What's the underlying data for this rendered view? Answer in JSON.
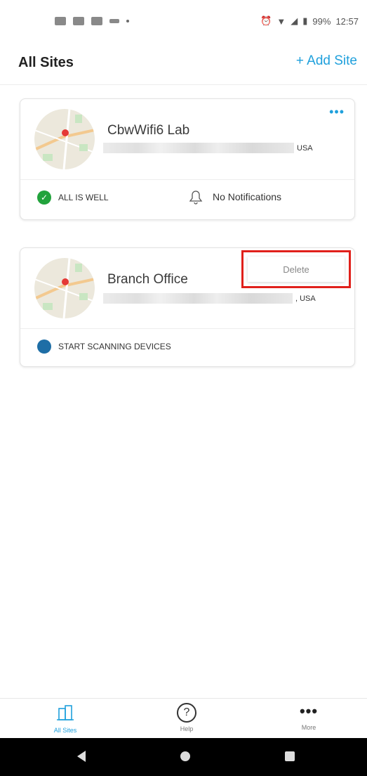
{
  "status_bar": {
    "battery": "99%",
    "time": "12:57",
    "icons": [
      "cast-icon",
      "sim-icon",
      "sim-icon",
      "usb-icon",
      "dot-icon",
      "alarm-icon",
      "wifi-icon",
      "signal-icon",
      "battery-icon"
    ]
  },
  "header": {
    "title": "All Sites",
    "add_site": "+ Add Site"
  },
  "sites": [
    {
      "name": "CbwWifi6 Lab",
      "country": "USA",
      "status": "ALL IS WELL",
      "notifications": "No Notifications"
    },
    {
      "name": "Branch Office",
      "country": ", USA",
      "status": "START SCANNING DEVICES"
    }
  ],
  "context_menu": {
    "delete_label": "Delete"
  },
  "bottom_nav": {
    "items": [
      {
        "label": "All Sites",
        "icon": "sites-icon",
        "active": true
      },
      {
        "label": "Help",
        "icon": "help-icon"
      },
      {
        "label": "More",
        "icon": "more-icon"
      }
    ]
  },
  "colors": {
    "accent": "#1fa0dc",
    "ok_green": "#22a33c",
    "highlight_red": "#e0201b",
    "scan_blue": "#1e6ea6"
  }
}
